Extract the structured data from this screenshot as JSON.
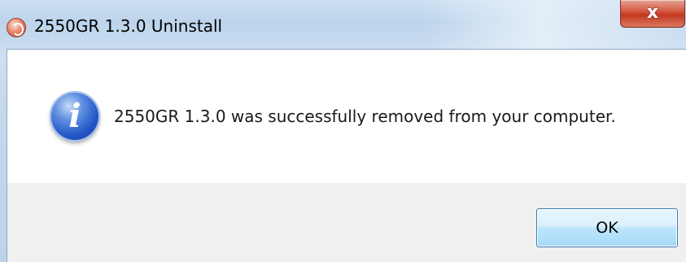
{
  "window": {
    "title": "2550GR 1.3.0 Uninstall",
    "close_glyph": "x",
    "app_icon": "installer-icon"
  },
  "dialog": {
    "icon": "info-icon",
    "icon_glyph": "i",
    "message": "2550GR 1.3.0 was successfully removed from your computer.",
    "ok_label": "OK"
  },
  "colors": {
    "titlebar": "#c5d9ec",
    "close_button": "#c3381f",
    "info_icon": "#2457c7",
    "ok_button_border": "#3c7fb1",
    "footer": "#f0f0f0"
  }
}
